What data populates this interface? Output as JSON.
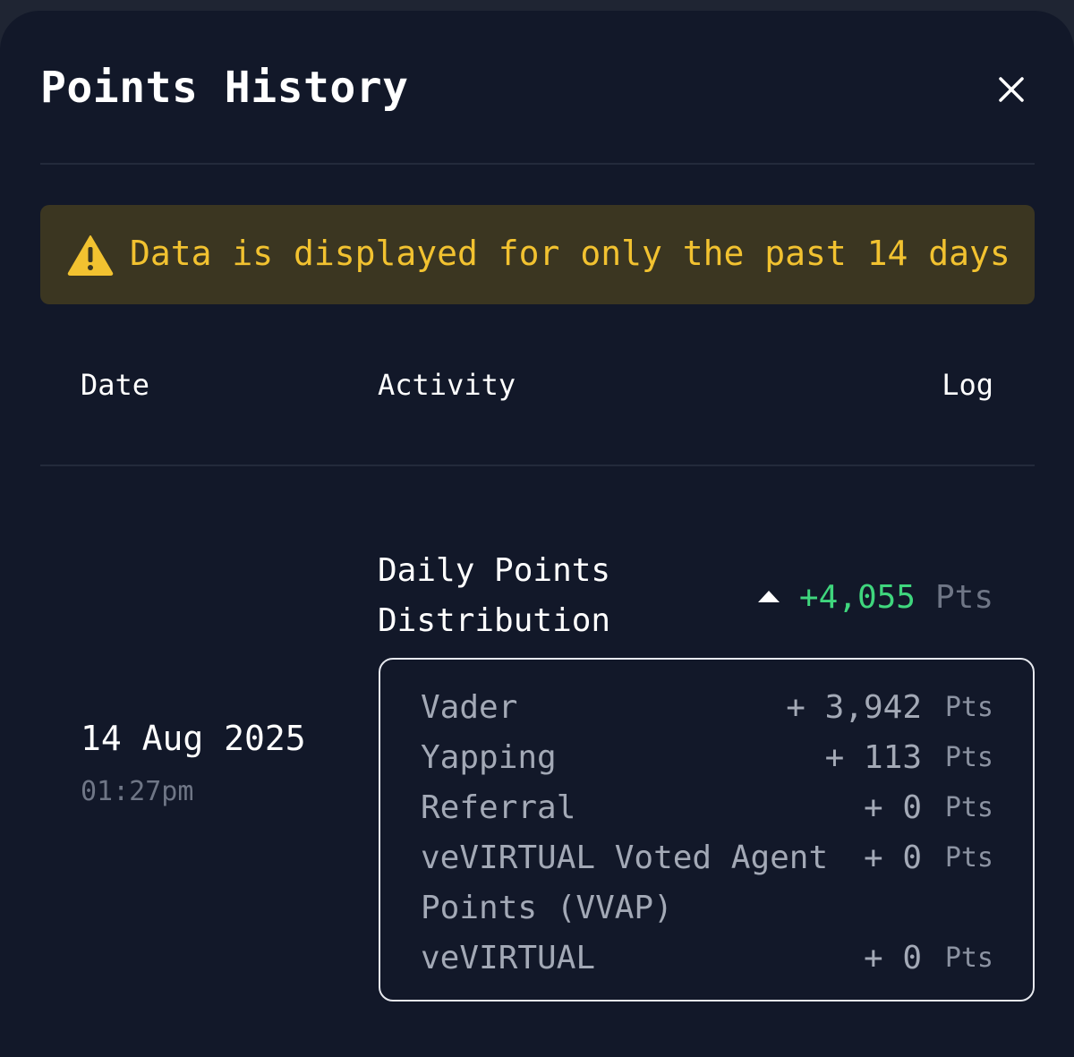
{
  "modal": {
    "title": "Points History",
    "close_icon": "close-icon"
  },
  "banner": {
    "icon": "warning-icon",
    "message": "Data is displayed for only the past 14 days",
    "text_color": "#f2c230",
    "background": "#3b3621"
  },
  "table": {
    "headers": {
      "date": "Date",
      "activity": "Activity",
      "log": "Log"
    },
    "rows": [
      {
        "date": "14 Aug 2025",
        "time": "01:27pm",
        "activity": "Daily Points Distribution",
        "trend_icon": "caret-up-icon",
        "log_value": "+4,055",
        "log_unit": "Pts",
        "breakdown": [
          {
            "label": "Vader",
            "amount": "+ 3,942",
            "unit": "Pts"
          },
          {
            "label": "Yapping",
            "amount": "+ 113",
            "unit": "Pts"
          },
          {
            "label": "Referral",
            "amount": "+ 0",
            "unit": "Pts"
          },
          {
            "label": "veVIRTUAL Voted Agent Points (VVAP)",
            "amount": "+ 0",
            "unit": "Pts"
          },
          {
            "label": "veVIRTUAL",
            "amount": "+ 0",
            "unit": "Pts"
          }
        ]
      }
    ]
  },
  "colors": {
    "background": "#121829",
    "positive": "#3fd67d",
    "muted": "#6f7686"
  }
}
